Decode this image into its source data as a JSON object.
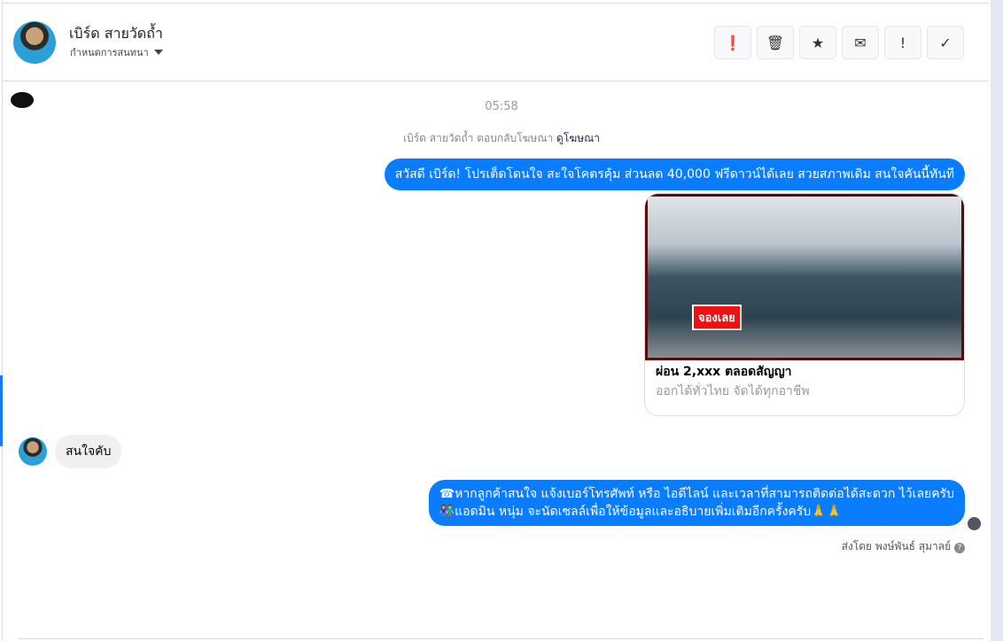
{
  "header": {
    "name": "เบิร์ด สายวัดถ้ำ",
    "subtitle": "กำหนดการสนทนา"
  },
  "actions": [
    {
      "icon": "alert-circle-icon",
      "glyph": "❗"
    },
    {
      "icon": "trash-icon",
      "glyph": "🗑"
    },
    {
      "icon": "star-icon",
      "glyph": "★"
    },
    {
      "icon": "envelope-icon",
      "glyph": "✉"
    },
    {
      "icon": "exclamation-icon",
      "glyph": "!"
    },
    {
      "icon": "check-icon",
      "glyph": "✓"
    }
  ],
  "chat": {
    "time": "05:58",
    "ad_note": "เบิร์ด สายวัดถ้ำ ตอบกลับโฆษณา",
    "ad_link": "ดูโฆษณา",
    "msg1": "สวัสดี เบิร์ด! โปรเต็ดโดนใจ สะใจโคตรคุ้ม ส่วนลด 40,000 ฟรีดาวน์ได้เลย สวยสภาพเดิม สนใจคันนี้ทันที",
    "card": {
      "badge": "จองเลย",
      "title": "ผ่อน 2,xxx ตลอดสัญญา",
      "subtitle": "ออกได้ทั่วไทย จัดได้ทุกอาชีพ"
    },
    "reply": "สนใจคับ",
    "msg2_line1": "☎หากลูกค้าสนใจ แจ้งเบอร์โทรศัพท์ หรือ ไอดีไลน์ และเวลาที่สามารถติดต่อได้สะดวก ไว้เลยครับ",
    "msg2_line2": "👫แอดมิน หนุ่ม จะนัดเซลล์เพื่อให้ข้อมูลและอธิบายเพิ่มเติมอีกครั้งครับ🙏🙏",
    "sent_by": "ส่งโดย พงษ์พันธ์ สุมาลย์",
    "help": "?"
  }
}
